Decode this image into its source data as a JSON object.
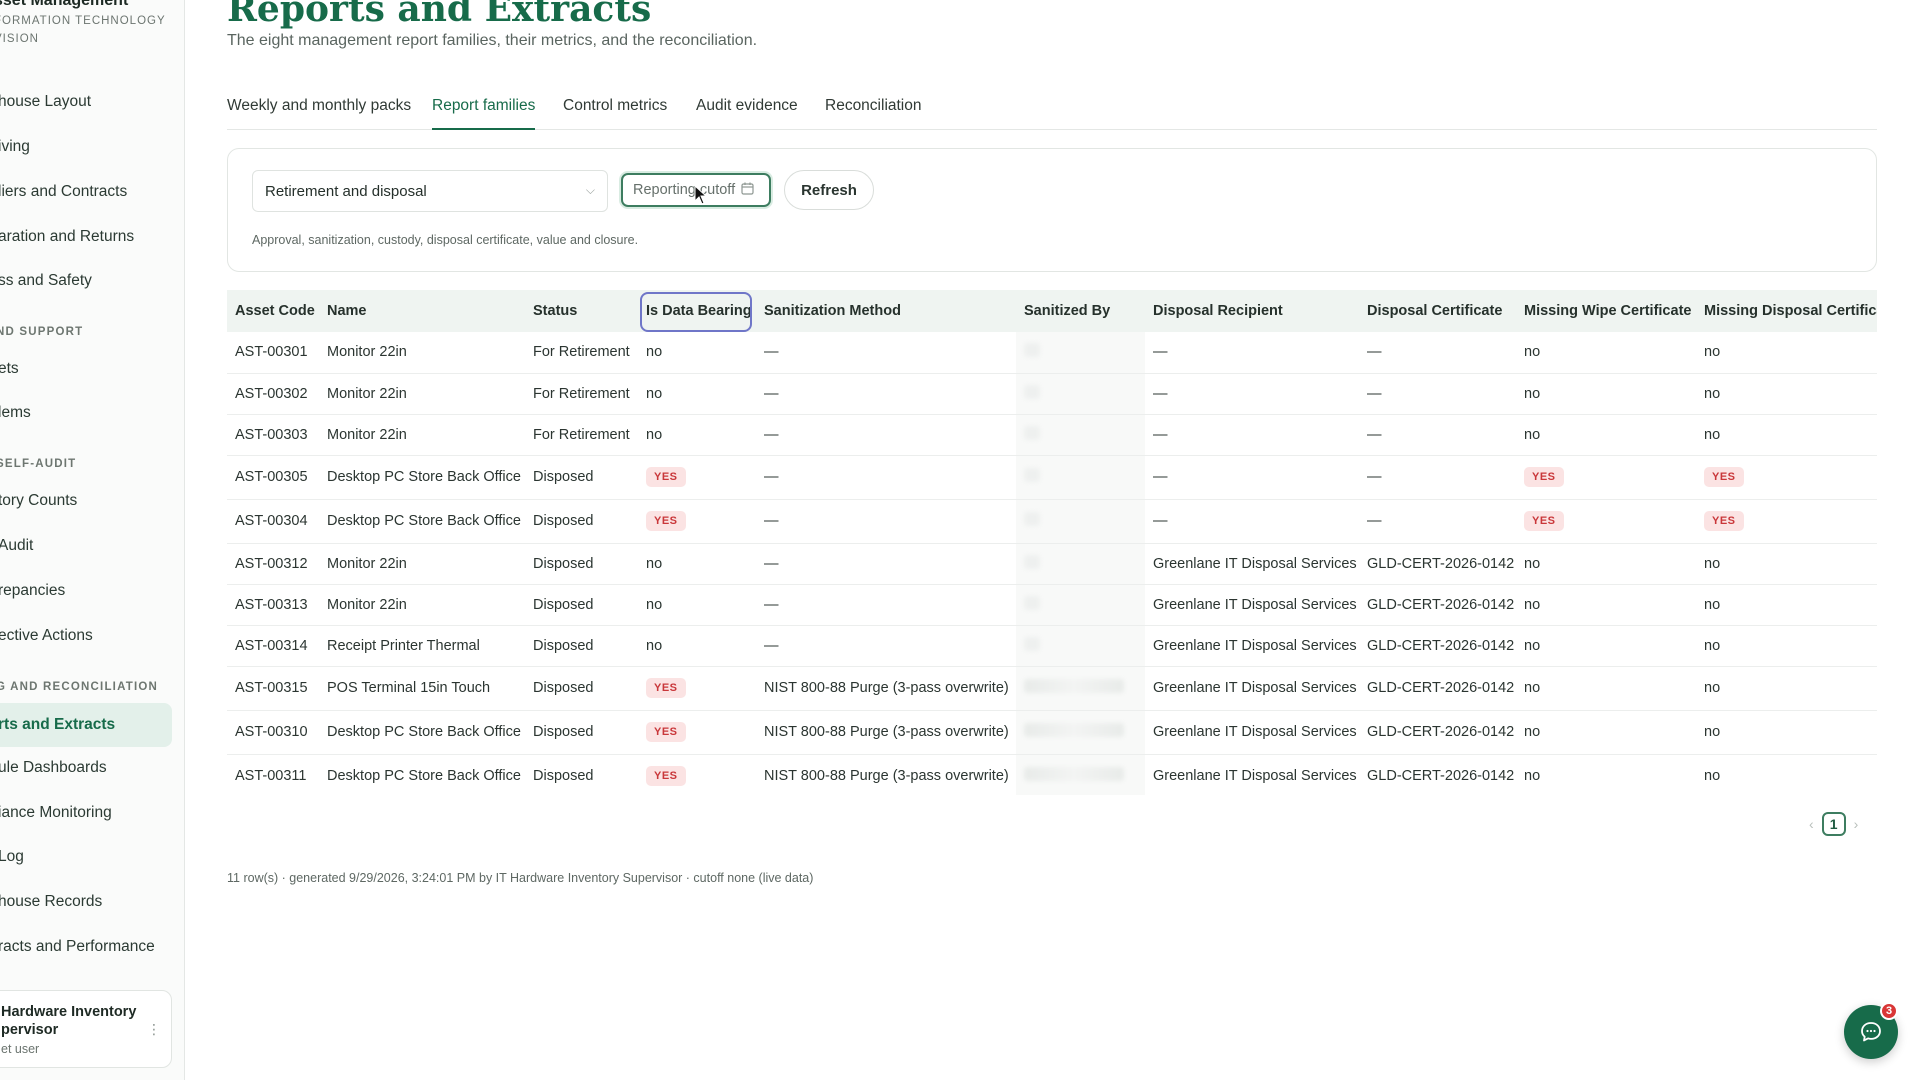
{
  "brand": {
    "name": "sset Management",
    "sub_line1": "FORMATION TECHNOLOGY",
    "sub_line2": "VISION"
  },
  "sidebar": {
    "items": [
      {
        "label": "house Layout"
      },
      {
        "label": "iving"
      },
      {
        "label": "liers and Contracts"
      },
      {
        "label": "aration and Returns"
      },
      {
        "label": "ss and Safety"
      },
      {
        "label": "ets"
      },
      {
        "label": "lems"
      },
      {
        "label": "tory Counts"
      },
      {
        "label": "Audit"
      },
      {
        "label": "repancies"
      },
      {
        "label": "ective Actions"
      },
      {
        "label": "rts and Extracts",
        "active": true
      },
      {
        "label": "ule Dashboards"
      },
      {
        "label": "iance Monitoring"
      },
      {
        "label": "Log"
      },
      {
        "label": "house Records"
      },
      {
        "label": "racts and Performance"
      }
    ],
    "sections": [
      {
        "label": "ND SUPPORT"
      },
      {
        "label": "SELF-AUDIT"
      },
      {
        "label": "G AND RECONCILIATION"
      }
    ],
    "user": {
      "name_line1": "Hardware Inventory",
      "name_line2": "pervisor",
      "role": "et user"
    }
  },
  "page": {
    "title": "Reports and Extracts",
    "subtitle": "The eight management report families, their metrics, and the reconciliation."
  },
  "tabs": [
    {
      "label": "Weekly and monthly packs"
    },
    {
      "label": "Report families",
      "active": true
    },
    {
      "label": "Control metrics"
    },
    {
      "label": "Audit evidence"
    },
    {
      "label": "Reconciliation"
    }
  ],
  "filters": {
    "family_select": "Retirement and disposal",
    "cutoff_placeholder": "Reporting cutoff",
    "refresh_label": "Refresh",
    "description": "Approval, sanitization, custody, disposal certificate, value and closure."
  },
  "table": {
    "columns": [
      "Asset Code",
      "Name",
      "Status",
      "Is Data Bearing",
      "Sanitization Method",
      "Sanitized By",
      "Disposal Recipient",
      "Disposal Certificate",
      "Missing Wipe Certificate",
      "Missing Disposal Certifica"
    ],
    "rows": [
      {
        "code": "AST-00301",
        "name": "Monitor 22in",
        "status": "For Retirement",
        "data_bearing": "no",
        "method": "—",
        "recipient": "—",
        "certificate": "—",
        "missing_wipe": "no",
        "missing_disposal": "no"
      },
      {
        "code": "AST-00302",
        "name": "Monitor 22in",
        "status": "For Retirement",
        "data_bearing": "no",
        "method": "—",
        "recipient": "—",
        "certificate": "—",
        "missing_wipe": "no",
        "missing_disposal": "no"
      },
      {
        "code": "AST-00303",
        "name": "Monitor 22in",
        "status": "For Retirement",
        "data_bearing": "no",
        "method": "—",
        "recipient": "—",
        "certificate": "—",
        "missing_wipe": "no",
        "missing_disposal": "no"
      },
      {
        "code": "AST-00305",
        "name": "Desktop PC Store Back Office",
        "status": "Disposed",
        "data_bearing": "YES",
        "method": "—",
        "recipient": "—",
        "certificate": "—",
        "missing_wipe": "YES",
        "missing_disposal": "YES"
      },
      {
        "code": "AST-00304",
        "name": "Desktop PC Store Back Office",
        "status": "Disposed",
        "data_bearing": "YES",
        "method": "—",
        "recipient": "—",
        "certificate": "—",
        "missing_wipe": "YES",
        "missing_disposal": "YES"
      },
      {
        "code": "AST-00312",
        "name": "Monitor 22in",
        "status": "Disposed",
        "data_bearing": "no",
        "method": "—",
        "recipient": "Greenlane IT Disposal Services",
        "certificate": "GLD-CERT-2026-0142",
        "missing_wipe": "no",
        "missing_disposal": "no"
      },
      {
        "code": "AST-00313",
        "name": "Monitor 22in",
        "status": "Disposed",
        "data_bearing": "no",
        "method": "—",
        "recipient": "Greenlane IT Disposal Services",
        "certificate": "GLD-CERT-2026-0142",
        "missing_wipe": "no",
        "missing_disposal": "no"
      },
      {
        "code": "AST-00314",
        "name": "Receipt Printer Thermal",
        "status": "Disposed",
        "data_bearing": "no",
        "method": "—",
        "recipient": "Greenlane IT Disposal Services",
        "certificate": "GLD-CERT-2026-0142",
        "missing_wipe": "no",
        "missing_disposal": "no"
      },
      {
        "code": "AST-00315",
        "name": "POS Terminal 15in Touch",
        "status": "Disposed",
        "data_bearing": "YES",
        "method": "NIST 800-88 Purge (3-pass overwrite)",
        "recipient": "Greenlane IT Disposal Services",
        "certificate": "GLD-CERT-2026-0142",
        "missing_wipe": "no",
        "missing_disposal": "no"
      },
      {
        "code": "AST-00310",
        "name": "Desktop PC Store Back Office",
        "status": "Disposed",
        "data_bearing": "YES",
        "method": "NIST 800-88 Purge (3-pass overwrite)",
        "recipient": "Greenlane IT Disposal Services",
        "certificate": "GLD-CERT-2026-0142",
        "missing_wipe": "no",
        "missing_disposal": "no"
      },
      {
        "code": "AST-00311",
        "name": "Desktop PC Store Back Office",
        "status": "Disposed",
        "data_bearing": "YES",
        "method": "NIST 800-88 Purge (3-pass overwrite)",
        "recipient": "Greenlane IT Disposal Services",
        "certificate": "GLD-CERT-2026-0142",
        "missing_wipe": "no",
        "missing_disposal": "no"
      }
    ]
  },
  "pager": {
    "current": "1"
  },
  "footer": {
    "note": "11 row(s) · generated 9/29/2026, 3:24:01 PM by IT Hardware Inventory Supervisor · cutoff none (live data)"
  },
  "chat": {
    "badge_count": "3"
  },
  "colors": {
    "accent": "#176b4a",
    "badge_bg": "#fbe3e3",
    "badge_text": "#c9373a"
  }
}
